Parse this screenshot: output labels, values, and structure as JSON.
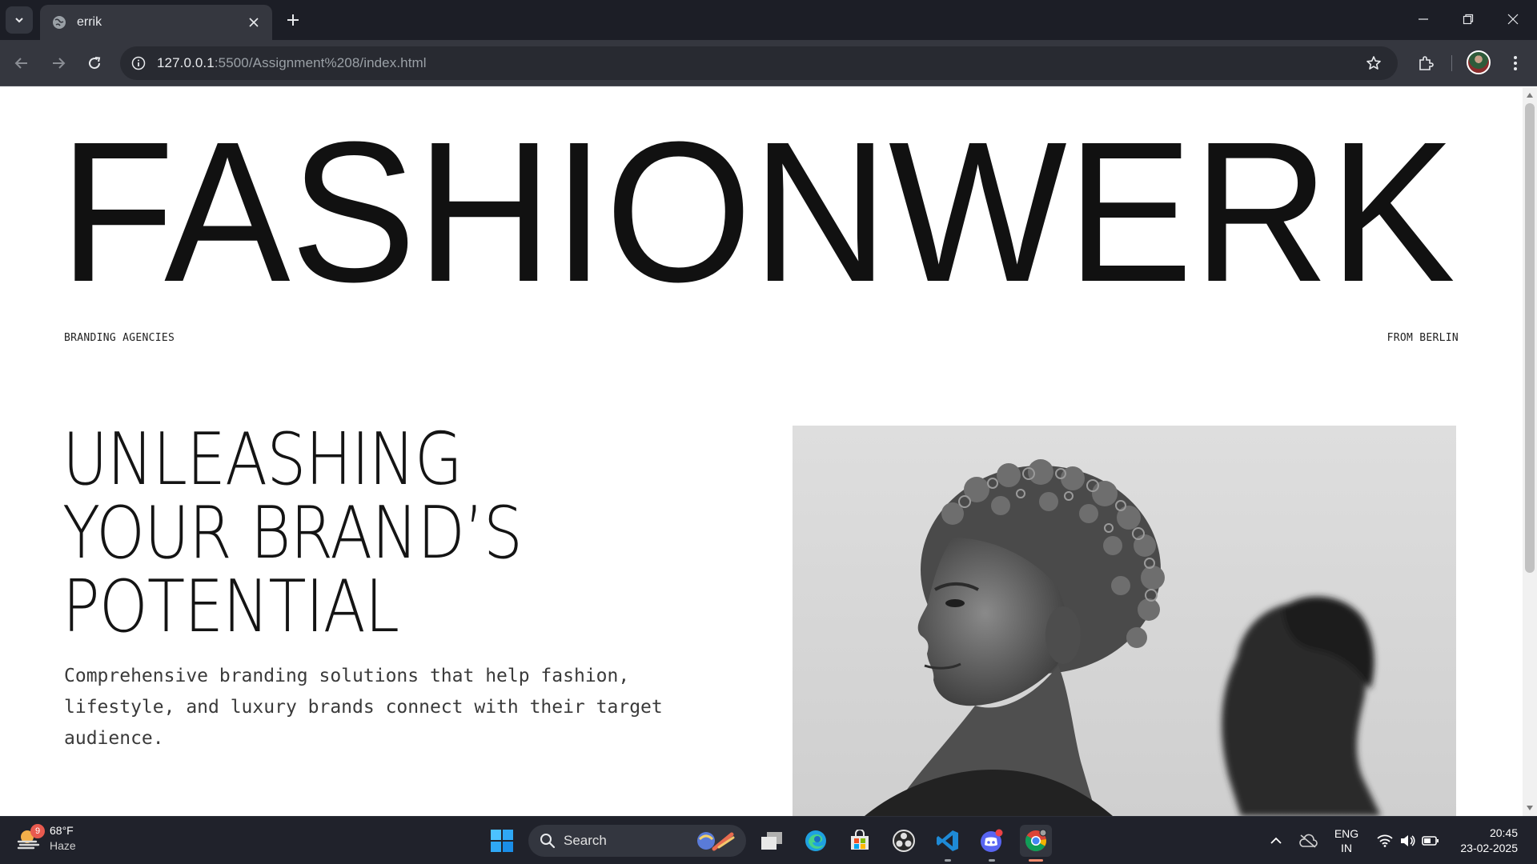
{
  "browser": {
    "tab_title": "errik",
    "url_host": "127.0.0.1",
    "url_path": ":5500/Assignment%208/index.html"
  },
  "page": {
    "brand": "FASHIONWERK",
    "subtitle_left": "BRANDING AGENCIES",
    "subtitle_right": "FROM BERLIN",
    "headline": [
      "UNLEASHING",
      "YOUR BRAND’S",
      "POTENTIAL"
    ],
    "description": "Comprehensive branding solutions that help fashion, lifestyle, and luxury brands connect with their target audience."
  },
  "taskbar": {
    "weather_badge": "9",
    "weather_temp": "68°F",
    "weather_condition": "Haze",
    "search_label": "Search",
    "language": "ENG",
    "region": "IN",
    "time": "20:45",
    "date": "23-02-2025"
  },
  "colors": {
    "tabbar_bg": "#1c1e26",
    "toolbar_bg": "#35373f",
    "page_text": "#141414",
    "taskbar_bg": "#20222b"
  }
}
